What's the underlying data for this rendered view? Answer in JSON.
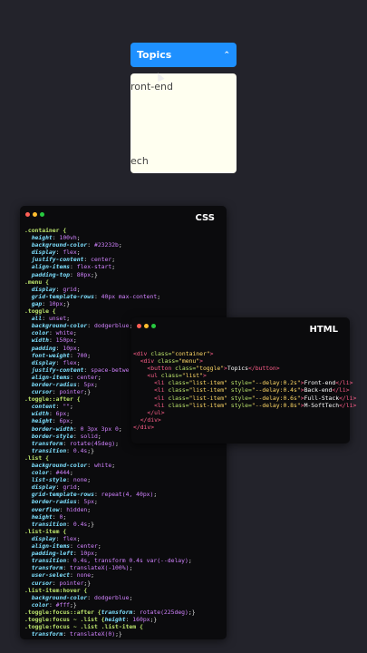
{
  "demo": {
    "toggle_label": "Topics",
    "toggle_chevron": "⌃",
    "visible_items": [
      "ront-end",
      "ech"
    ]
  },
  "css_window": {
    "title": "CSS",
    "lines": [
      [
        [
          ".container {",
          "sel"
        ]
      ],
      [
        [
          "  height",
          "prop"
        ],
        [
          ": ",
          "punc"
        ],
        [
          "100vh",
          "val"
        ],
        [
          ";",
          "punc"
        ]
      ],
      [
        [
          "  background-color",
          "prop"
        ],
        [
          ": ",
          "punc"
        ],
        [
          "#23232b",
          "val"
        ],
        [
          ";",
          "punc"
        ]
      ],
      [
        [
          "  display",
          "prop"
        ],
        [
          ": ",
          "punc"
        ],
        [
          "flex",
          "val"
        ],
        [
          ";",
          "punc"
        ]
      ],
      [
        [
          "  justify-content",
          "prop"
        ],
        [
          ": ",
          "punc"
        ],
        [
          "center",
          "val"
        ],
        [
          ";",
          "punc"
        ]
      ],
      [
        [
          "  align-items",
          "prop"
        ],
        [
          ": ",
          "punc"
        ],
        [
          "flex-start",
          "val"
        ],
        [
          ";",
          "punc"
        ]
      ],
      [
        [
          "  padding-top",
          "prop"
        ],
        [
          ": ",
          "punc"
        ],
        [
          "80px",
          "val"
        ],
        [
          ";}",
          "punc"
        ]
      ],
      [
        [
          ".menu {",
          "sel"
        ]
      ],
      [
        [
          "  display",
          "prop"
        ],
        [
          ": ",
          "punc"
        ],
        [
          "grid",
          "val"
        ],
        [
          ";",
          "punc"
        ]
      ],
      [
        [
          "  grid-template-rows",
          "prop"
        ],
        [
          ": ",
          "punc"
        ],
        [
          "40px max-content",
          "val"
        ],
        [
          ";",
          "punc"
        ]
      ],
      [
        [
          "  gap",
          "prop"
        ],
        [
          ": ",
          "punc"
        ],
        [
          "10px",
          "val"
        ],
        [
          ";}",
          "punc"
        ]
      ],
      [
        [
          ".toggle {",
          "sel"
        ]
      ],
      [
        [
          "  all",
          "prop"
        ],
        [
          ": ",
          "punc"
        ],
        [
          "unset",
          "val"
        ],
        [
          ";",
          "punc"
        ]
      ],
      [
        [
          "  background-color",
          "prop"
        ],
        [
          ": ",
          "punc"
        ],
        [
          "dodgerblue",
          "val"
        ],
        [
          ";",
          "punc"
        ]
      ],
      [
        [
          "  color",
          "prop"
        ],
        [
          ": ",
          "punc"
        ],
        [
          "white",
          "val"
        ],
        [
          ";",
          "punc"
        ]
      ],
      [
        [
          "  width",
          "prop"
        ],
        [
          ": ",
          "punc"
        ],
        [
          "150px",
          "val"
        ],
        [
          ";",
          "punc"
        ]
      ],
      [
        [
          "  padding",
          "prop"
        ],
        [
          ": ",
          "punc"
        ],
        [
          "10px",
          "val"
        ],
        [
          ";",
          "punc"
        ]
      ],
      [
        [
          "  font-weight",
          "prop"
        ],
        [
          ": ",
          "punc"
        ],
        [
          "700",
          "val"
        ],
        [
          ";",
          "punc"
        ]
      ],
      [
        [
          "  display",
          "prop"
        ],
        [
          ": ",
          "punc"
        ],
        [
          "flex",
          "val"
        ],
        [
          ";",
          "punc"
        ]
      ],
      [
        [
          "  justify-content",
          "prop"
        ],
        [
          ": ",
          "punc"
        ],
        [
          "space-betwe",
          "val"
        ]
      ],
      [
        [
          "  align-items",
          "prop"
        ],
        [
          ": ",
          "punc"
        ],
        [
          "center",
          "val"
        ],
        [
          ";",
          "punc"
        ]
      ],
      [
        [
          "  border-radius",
          "prop"
        ],
        [
          ": ",
          "punc"
        ],
        [
          "5px",
          "val"
        ],
        [
          ";",
          "punc"
        ]
      ],
      [
        [
          "  cursor",
          "prop"
        ],
        [
          ": ",
          "punc"
        ],
        [
          "pointer",
          "val"
        ],
        [
          ";}",
          "punc"
        ]
      ],
      [
        [
          ".toggle::after {",
          "sel"
        ]
      ],
      [
        [
          "  content",
          "prop"
        ],
        [
          ": ",
          "punc"
        ],
        [
          "\"\"",
          "val"
        ],
        [
          ";",
          "punc"
        ]
      ],
      [
        [
          "  width",
          "prop"
        ],
        [
          ": ",
          "punc"
        ],
        [
          "6px",
          "val"
        ],
        [
          ";",
          "punc"
        ]
      ],
      [
        [
          "  height",
          "prop"
        ],
        [
          ": ",
          "punc"
        ],
        [
          "6px",
          "val"
        ],
        [
          ";",
          "punc"
        ]
      ],
      [
        [
          "  border-width",
          "prop"
        ],
        [
          ": ",
          "punc"
        ],
        [
          "0 3px 3px 0",
          "val"
        ],
        [
          ";",
          "punc"
        ]
      ],
      [
        [
          "  border-style",
          "prop"
        ],
        [
          ": ",
          "punc"
        ],
        [
          "solid",
          "val"
        ],
        [
          ";",
          "punc"
        ]
      ],
      [
        [
          "  transform",
          "prop"
        ],
        [
          ": ",
          "punc"
        ],
        [
          "rotate(45deg)",
          "val"
        ],
        [
          ";",
          "punc"
        ]
      ],
      [
        [
          "  transition",
          "prop"
        ],
        [
          ": ",
          "punc"
        ],
        [
          "0.4s",
          "val"
        ],
        [
          ";}",
          "punc"
        ]
      ],
      [
        [
          ".list {",
          "sel"
        ]
      ],
      [
        [
          "  background-color",
          "prop"
        ],
        [
          ": ",
          "punc"
        ],
        [
          "white",
          "val"
        ],
        [
          ";",
          "punc"
        ]
      ],
      [
        [
          "  color",
          "prop"
        ],
        [
          ": ",
          "punc"
        ],
        [
          "#444",
          "val"
        ],
        [
          ";",
          "punc"
        ]
      ],
      [
        [
          "  list-style",
          "prop"
        ],
        [
          ": ",
          "punc"
        ],
        [
          "none",
          "val"
        ],
        [
          ";",
          "punc"
        ]
      ],
      [
        [
          "  display",
          "prop"
        ],
        [
          ": ",
          "punc"
        ],
        [
          "grid",
          "val"
        ],
        [
          ";",
          "punc"
        ]
      ],
      [
        [
          "  grid-template-rows",
          "prop"
        ],
        [
          ": ",
          "punc"
        ],
        [
          "repeat(4, 40px)",
          "val"
        ],
        [
          ";",
          "punc"
        ]
      ],
      [
        [
          "  border-radius",
          "prop"
        ],
        [
          ": ",
          "punc"
        ],
        [
          "5px",
          "val"
        ],
        [
          ";",
          "punc"
        ]
      ],
      [
        [
          "  overflow",
          "prop"
        ],
        [
          ": ",
          "punc"
        ],
        [
          "hidden",
          "val"
        ],
        [
          ";",
          "punc"
        ]
      ],
      [
        [
          "  height",
          "prop"
        ],
        [
          ": ",
          "punc"
        ],
        [
          "0",
          "val"
        ],
        [
          ";",
          "punc"
        ]
      ],
      [
        [
          "  transition",
          "prop"
        ],
        [
          ": ",
          "punc"
        ],
        [
          "0.4s",
          "val"
        ],
        [
          ";}",
          "punc"
        ]
      ],
      [
        [
          ".list-item {",
          "sel"
        ]
      ],
      [
        [
          "  display",
          "prop"
        ],
        [
          ": ",
          "punc"
        ],
        [
          "flex",
          "val"
        ],
        [
          ";",
          "punc"
        ]
      ],
      [
        [
          "  align-items",
          "prop"
        ],
        [
          ": ",
          "punc"
        ],
        [
          "center",
          "val"
        ],
        [
          ";",
          "punc"
        ]
      ],
      [
        [
          "  padding-left",
          "prop"
        ],
        [
          ": ",
          "punc"
        ],
        [
          "10px",
          "val"
        ],
        [
          ";",
          "punc"
        ]
      ],
      [
        [
          "  transition",
          "prop"
        ],
        [
          ": ",
          "punc"
        ],
        [
          "0.4s, transform 0.4s var(--delay)",
          "val"
        ],
        [
          ";",
          "punc"
        ]
      ],
      [
        [
          "  transform",
          "prop"
        ],
        [
          ": ",
          "punc"
        ],
        [
          "translateX(-100%)",
          "val"
        ],
        [
          ";",
          "punc"
        ]
      ],
      [
        [
          "  user-select",
          "prop"
        ],
        [
          ": ",
          "punc"
        ],
        [
          "none",
          "val"
        ],
        [
          ";",
          "punc"
        ]
      ],
      [
        [
          "  cursor",
          "prop"
        ],
        [
          ": ",
          "punc"
        ],
        [
          "pointer",
          "val"
        ],
        [
          ";}",
          "punc"
        ]
      ],
      [
        [
          ".list-item:hover {",
          "sel"
        ]
      ],
      [
        [
          "  background-color",
          "prop"
        ],
        [
          ": ",
          "punc"
        ],
        [
          "dodgerblue",
          "val"
        ],
        [
          ";",
          "punc"
        ]
      ],
      [
        [
          "  color",
          "prop"
        ],
        [
          ": ",
          "punc"
        ],
        [
          "#fff",
          "val"
        ],
        [
          ";}",
          "punc"
        ]
      ],
      [
        [
          ".toggle:focus::after {",
          "sel"
        ],
        [
          "transform",
          "prop"
        ],
        [
          ": ",
          "punc"
        ],
        [
          "rotate(225deg)",
          "val"
        ],
        [
          ";}",
          "punc"
        ]
      ],
      [
        [
          ".toggle:focus ~ .list {",
          "sel"
        ],
        [
          "height",
          "prop"
        ],
        [
          ": ",
          "punc"
        ],
        [
          "160px",
          "val"
        ],
        [
          ";}",
          "punc"
        ]
      ],
      [
        [
          ".toggle:focus ~ .list .list-item {",
          "sel"
        ]
      ],
      [
        [
          "  transform",
          "prop"
        ],
        [
          ": ",
          "punc"
        ],
        [
          "translateX(0)",
          "val"
        ],
        [
          ";}",
          "punc"
        ]
      ]
    ]
  },
  "html_window": {
    "title": "HTML",
    "lines": [
      [
        [
          "<div ",
          "tag"
        ],
        [
          "class=",
          "attr"
        ],
        [
          "\"container\"",
          "str"
        ],
        [
          ">",
          "tag"
        ]
      ],
      [
        [
          "  <div ",
          "tag"
        ],
        [
          "class=",
          "attr"
        ],
        [
          "\"menu\"",
          "str"
        ],
        [
          ">",
          "tag"
        ]
      ],
      [
        [
          "    <button ",
          "tag"
        ],
        [
          "class=",
          "attr"
        ],
        [
          "\"toggle\"",
          "str"
        ],
        [
          ">",
          "tag"
        ],
        [
          "Topics",
          "txt"
        ],
        [
          "</button>",
          "tag"
        ]
      ],
      [
        [
          "    <ul ",
          "tag"
        ],
        [
          "class=",
          "attr"
        ],
        [
          "\"list\"",
          "str"
        ],
        [
          ">",
          "tag"
        ]
      ],
      [
        [
          "      <li ",
          "tag"
        ],
        [
          "class=",
          "attr"
        ],
        [
          "\"list-item\" ",
          "str"
        ],
        [
          "style=",
          "attr"
        ],
        [
          "\"--delay:0.2s\"",
          "str"
        ],
        [
          ">",
          "tag"
        ],
        [
          "Front-end",
          "txt"
        ],
        [
          "</li>",
          "tag"
        ]
      ],
      [
        [
          "      <li ",
          "tag"
        ],
        [
          "class=",
          "attr"
        ],
        [
          "\"list-item\" ",
          "str"
        ],
        [
          "style=",
          "attr"
        ],
        [
          "\"--delay:0.4s\"",
          "str"
        ],
        [
          ">",
          "tag"
        ],
        [
          "Back-end",
          "txt"
        ],
        [
          "</li>",
          "tag"
        ]
      ],
      [
        [
          "      <li ",
          "tag"
        ],
        [
          "class=",
          "attr"
        ],
        [
          "\"list-item\" ",
          "str"
        ],
        [
          "style=",
          "attr"
        ],
        [
          "\"--delay:0.6s\"",
          "str"
        ],
        [
          ">",
          "tag"
        ],
        [
          "Full-Stack",
          "txt"
        ],
        [
          "</li>",
          "tag"
        ]
      ],
      [
        [
          "      <li ",
          "tag"
        ],
        [
          "class=",
          "attr"
        ],
        [
          "\"list-item\" ",
          "str"
        ],
        [
          "style=",
          "attr"
        ],
        [
          "\"--delay:0.8s\"",
          "str"
        ],
        [
          ">",
          "tag"
        ],
        [
          "M-SoftTech",
          "txt"
        ],
        [
          "</li>",
          "tag"
        ]
      ],
      [
        [
          "    </ul>",
          "tag"
        ]
      ],
      [
        [
          "  </div>",
          "tag"
        ]
      ],
      [
        [
          "</div>",
          "tag"
        ]
      ]
    ]
  }
}
